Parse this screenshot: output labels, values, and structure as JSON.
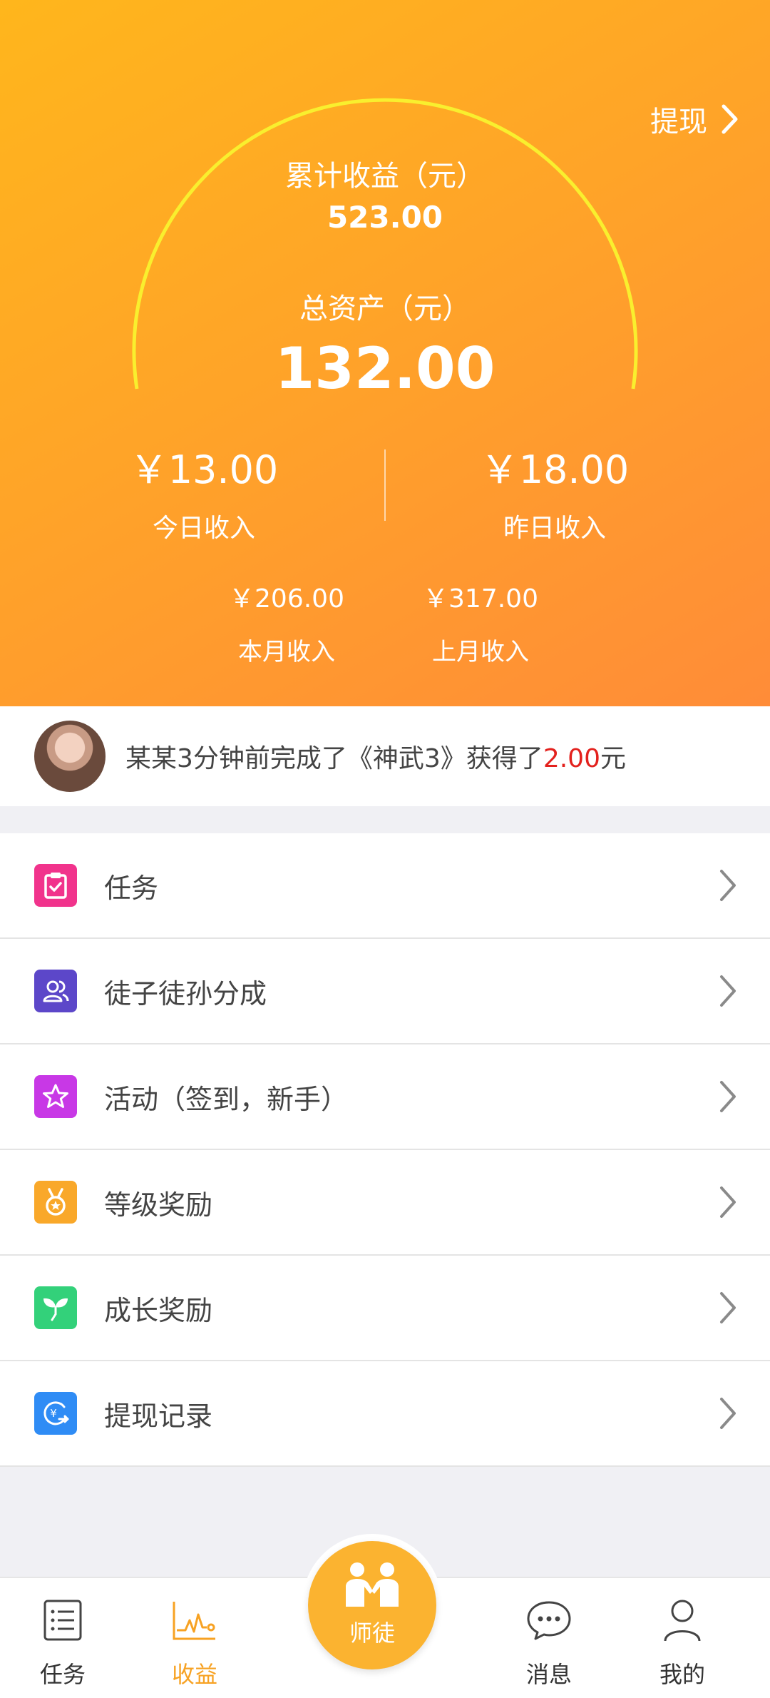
{
  "colors": {
    "header_gradient_start": "#ffb61c",
    "header_gradient_end": "#ff8c38",
    "arc": "#f9ef2e",
    "accent": "#f7a223",
    "highlight_red": "#e3211d"
  },
  "header": {
    "withdraw_label": "提现",
    "cumulative_label": "累计收益（元）",
    "cumulative_value": "523.00",
    "total_assets_label": "总资产（元）",
    "total_assets_value": "132.00",
    "today": {
      "value": "￥13.00",
      "label": "今日收入"
    },
    "yesterday": {
      "value": "￥18.00",
      "label": "昨日收入"
    },
    "this_month": {
      "value": "￥206.00",
      "label": "本月收入"
    },
    "last_month": {
      "value": "￥317.00",
      "label": "上月收入"
    }
  },
  "notice": {
    "text_prefix": "某某3分钟前完成了《神武3》获得了",
    "amount": "2.00",
    "text_suffix": "元"
  },
  "menu": [
    {
      "label": "任务",
      "icon": "clipboard-check-icon",
      "color": "#f1338c"
    },
    {
      "label": "徒子徒孙分成",
      "icon": "users-icon",
      "color": "#5c47c9"
    },
    {
      "label": "活动（签到，新手）",
      "icon": "star-icon",
      "color": "#c838e6"
    },
    {
      "label": "等级奖励",
      "icon": "medal-icon",
      "color": "#f9a82a"
    },
    {
      "label": "成长奖励",
      "icon": "sprout-icon",
      "color": "#33d17a"
    },
    {
      "label": "提现记录",
      "icon": "yuan-transfer-icon",
      "color": "#2f8cf5"
    }
  ],
  "tabbar": {
    "task": "任务",
    "earnings": "收益",
    "center": "师徒",
    "messages": "消息",
    "mine": "我的"
  }
}
